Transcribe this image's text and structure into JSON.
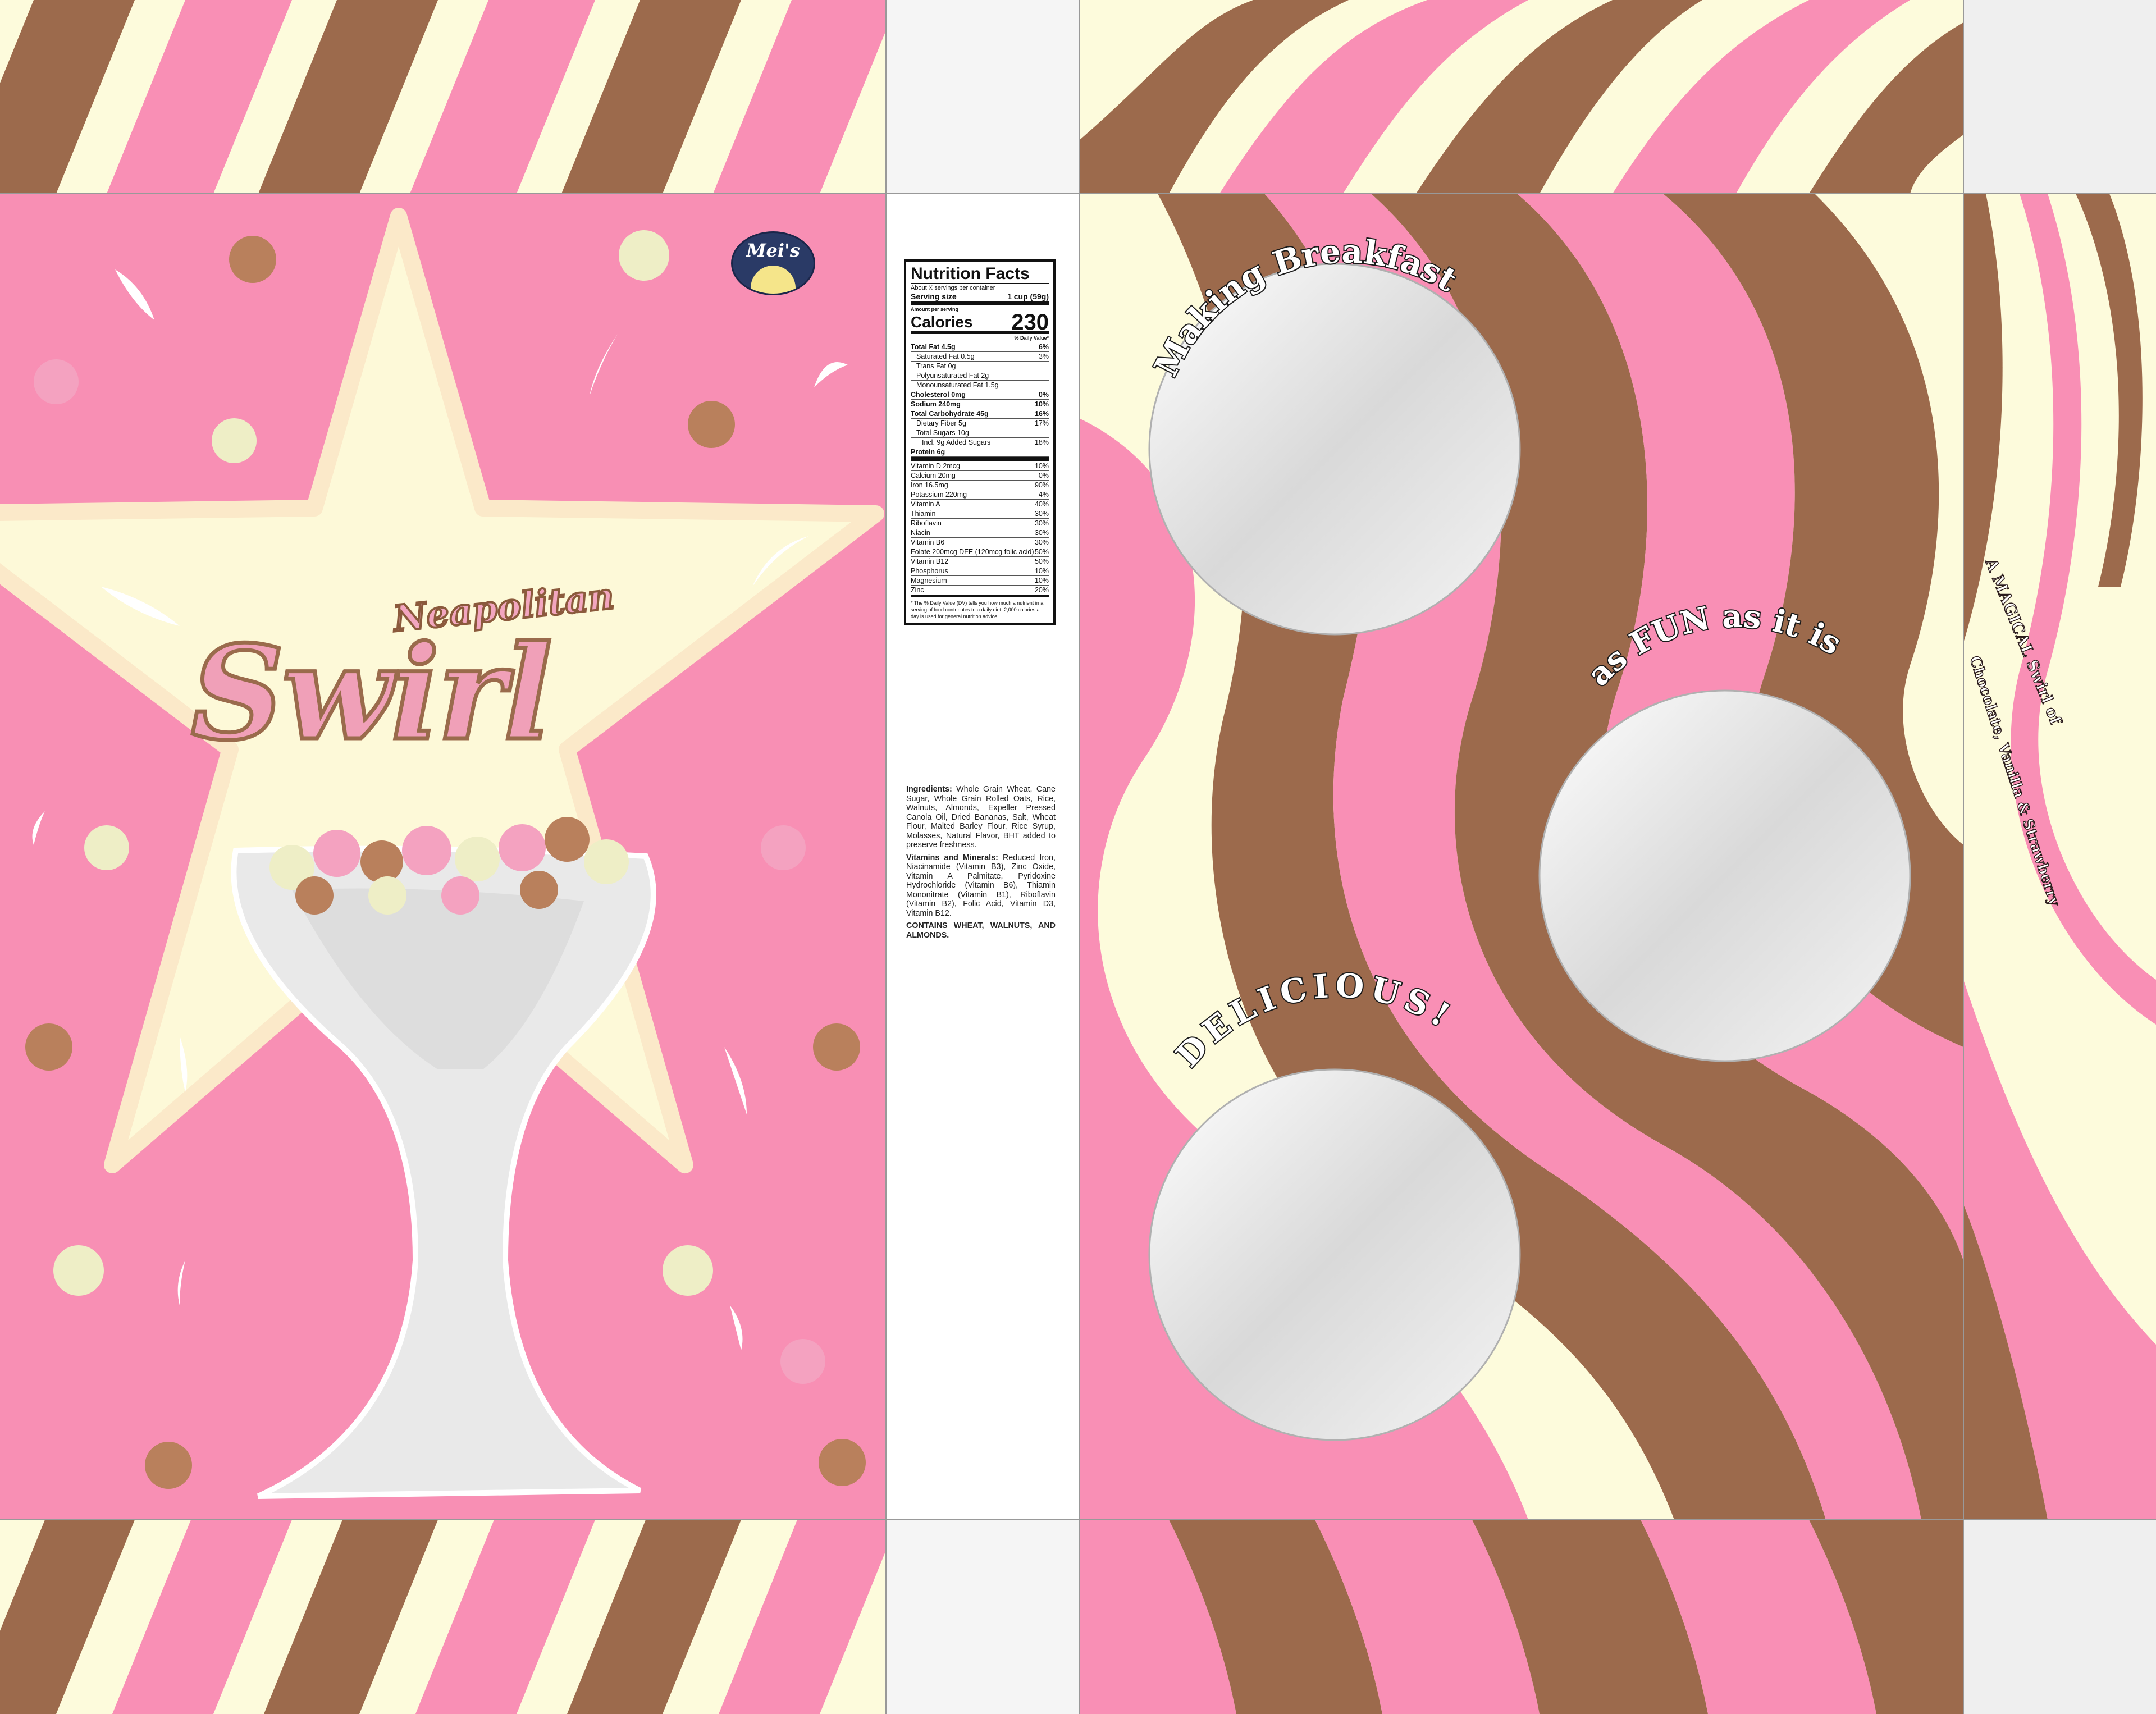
{
  "brand": {
    "logo_text": "Mei's"
  },
  "front": {
    "title_line1": "Neapolitan",
    "title_line2": "Swirl"
  },
  "back_panel": {
    "slogan_1": "Making Breakfast",
    "slogan_2": "as FUN as it is",
    "slogan_3": "DELICIOUS!"
  },
  "side_panel": {
    "line_1": "A MAGICAL Swirl of",
    "line_2": "Chocolate, Vanilla & Strawberry"
  },
  "nutrition": {
    "title": "Nutrition Facts",
    "servings": "About X servings per container",
    "serving_size_label": "Serving size",
    "serving_size_value": "1 cup (59g)",
    "amount_per_serving": "Amount per serving",
    "calories_label": "Calories",
    "calories_value": "230",
    "dv_header": "% Daily Value*",
    "rows": [
      {
        "label": "Total Fat 4.5g",
        "dv": "6%",
        "style": "b"
      },
      {
        "label": "Saturated Fat 0.5g",
        "dv": "3%",
        "style": "i1"
      },
      {
        "label": "Trans Fat 0g",
        "dv": "",
        "style": "i1"
      },
      {
        "label": "Polyunsaturated Fat 2g",
        "dv": "",
        "style": "i1"
      },
      {
        "label": "Monounsaturated Fat 1.5g",
        "dv": "",
        "style": "i1"
      },
      {
        "label": "Cholesterol 0mg",
        "dv": "0%",
        "style": "b"
      },
      {
        "label": "Sodium 240mg",
        "dv": "10%",
        "style": "b"
      },
      {
        "label": "Total Carbohydrate 45g",
        "dv": "16%",
        "style": "b"
      },
      {
        "label": "Dietary Fiber 5g",
        "dv": "17%",
        "style": "i1"
      },
      {
        "label": "Total Sugars 10g",
        "dv": "",
        "style": "i1"
      },
      {
        "label": "Incl. 9g Added Sugars",
        "dv": "18%",
        "style": "i2"
      },
      {
        "label": "Protein 6g",
        "dv": "",
        "style": "b"
      }
    ],
    "vitamins": [
      {
        "label": "Vitamin D 2mcg",
        "dv": "10%"
      },
      {
        "label": "Calcium 20mg",
        "dv": "0%"
      },
      {
        "label": "Iron 16.5mg",
        "dv": "90%"
      },
      {
        "label": "Potassium 220mg",
        "dv": "4%"
      },
      {
        "label": "Vitamin A",
        "dv": "40%"
      },
      {
        "label": "Thiamin",
        "dv": "30%"
      },
      {
        "label": "Riboflavin",
        "dv": "30%"
      },
      {
        "label": "Niacin",
        "dv": "30%"
      },
      {
        "label": "Vitamin B6",
        "dv": "30%"
      },
      {
        "label": "Folate 200mcg DFE (120mcg folic acid)",
        "dv": "50%"
      },
      {
        "label": "Vitamin B12",
        "dv": "50%"
      },
      {
        "label": "Phosphorus",
        "dv": "10%"
      },
      {
        "label": "Magnesium",
        "dv": "10%"
      },
      {
        "label": "Zinc",
        "dv": "20%"
      }
    ],
    "footnote": "* The % Daily Value (DV) tells you how much a nutrient in a serving of food contributes to a daily diet. 2,000 calories a day is used for general nutrition advice."
  },
  "ingredients": {
    "label": "Ingredients:",
    "text": "Whole Grain Wheat, Cane Sugar, Whole Grain Rolled Oats, Rice, Walnuts, Almonds, Expeller Pressed Canola Oil, Dried Bananas, Salt, Wheat Flour, Malted Barley Flour, Rice Syrup, Molasses, Natural Flavor, BHT added to preserve freshness.",
    "vit_label": "Vitamins and Minerals:",
    "vit_text": "Reduced Iron, Niacinamide (Vitamin B3), Zinc Oxide, Vitamin A Palmitate, Pyridoxine Hydrochloride (Vitamin B6), Thiamin Mononitrate (Vitamin B1), Riboflavin (Vitamin B2), Folic Acid, Vitamin D3, Vitamin B12.",
    "contains": "CONTAINS WHEAT, WALNUTS, AND ALMONDS."
  },
  "colors": {
    "pink": "#f98fb5",
    "brown": "#9c6a4c",
    "cream": "#fdfbdc",
    "star": "#fdf9d8",
    "silver": "#e6e6e6"
  }
}
